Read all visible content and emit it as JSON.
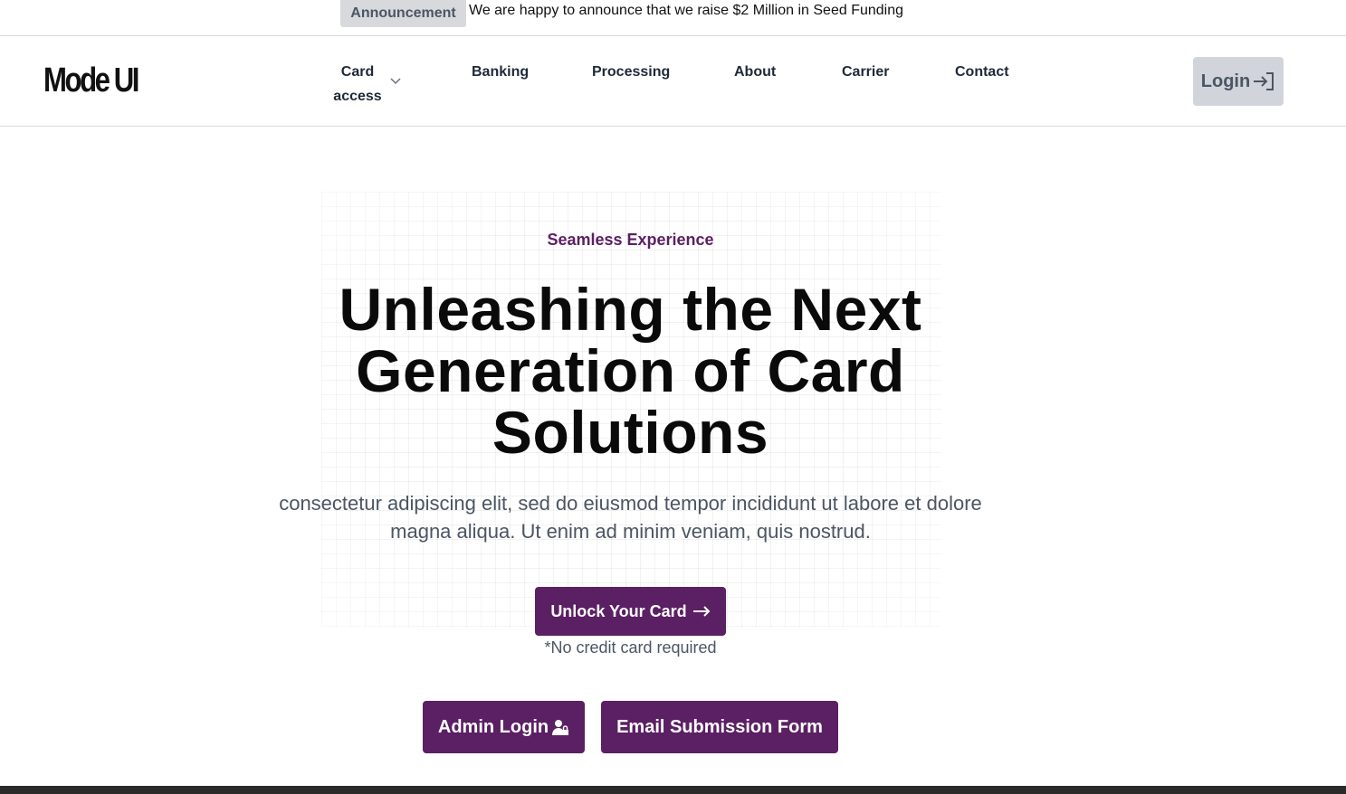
{
  "announcement": {
    "badge": "Announcement",
    "text": "We are happy to announce that we raise $2 Million in Seed Funding"
  },
  "navbar": {
    "logo": "Mode UI",
    "items": [
      {
        "label": "Card access",
        "has_dropdown": true
      },
      {
        "label": "Banking"
      },
      {
        "label": "Processing"
      },
      {
        "label": "About"
      },
      {
        "label": "Carrier"
      },
      {
        "label": "Contact"
      }
    ],
    "login_label": "Login"
  },
  "hero": {
    "eyebrow": "Seamless Experience",
    "headline": "Unleashing the Next Generation of Card Solutions",
    "subtext": "consectetur adipiscing elit, sed do eiusmod tempor incididunt ut labore et dolore magna aliqua. Ut enim ad minim veniam, quis nostrud.",
    "cta_label": "Unlock Your Card",
    "cta_note": "*No credit card required"
  },
  "actions": {
    "admin_login_label": "Admin Login",
    "email_form_label": "Email Submission Form"
  },
  "colors": {
    "accent": "#5b1f63",
    "badge_bg": "#d8d9dd",
    "login_bg": "#d1d5db"
  },
  "icons": {
    "login": "login-arrow-icon",
    "chevron": "chevron-down-icon",
    "cta_arrow": "arrow-right-icon",
    "admin": "user-lock-icon"
  }
}
